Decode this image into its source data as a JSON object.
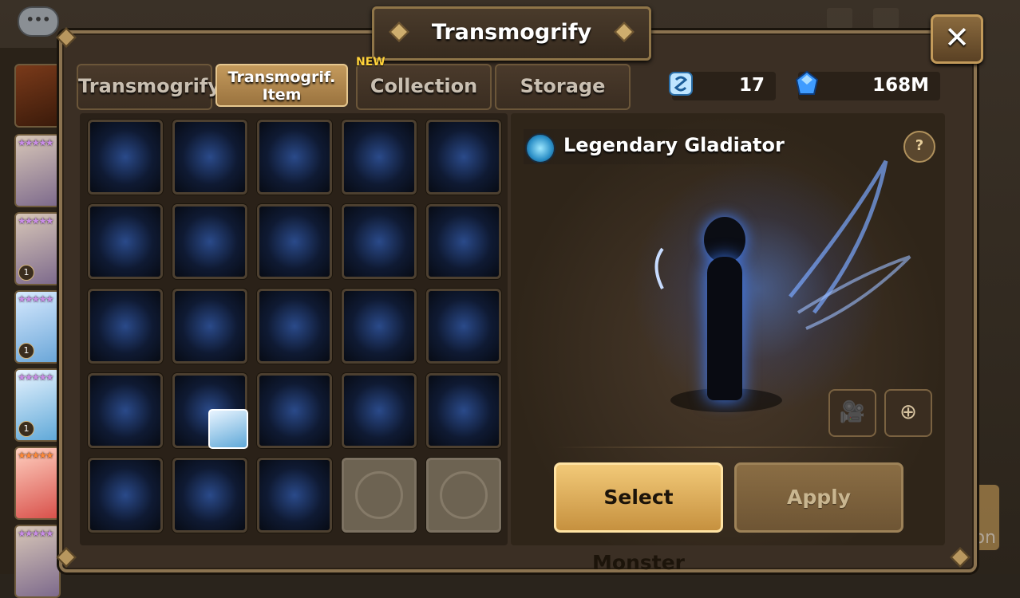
{
  "window": {
    "title": "Transmogrify",
    "close_glyph": "✕"
  },
  "tabs": [
    {
      "label": "Transmogrify",
      "active": false
    },
    {
      "label": "Transmogrif. Item",
      "active": true
    },
    {
      "label": "Collection",
      "active": false,
      "badge": "NEW"
    },
    {
      "label": "Storage",
      "active": false
    }
  ],
  "currency": {
    "transmog_stone": {
      "icon": "transmog-stone-icon",
      "value": "17"
    },
    "crystal": {
      "icon": "crystal-icon",
      "value": "168M"
    }
  },
  "preview": {
    "item_name": "Legendary Gladiator",
    "help_glyph": "?",
    "video_icon": "video-camera-icon",
    "zoom_icon": "zoom-in-icon"
  },
  "actions": {
    "select_monster": "Select Monster",
    "apply": "Apply"
  },
  "monster_list": [
    {
      "stars": "★★★★",
      "level": ""
    },
    {
      "stars": "★★★★★",
      "level": ""
    },
    {
      "stars": "★★★★★",
      "level": "1"
    },
    {
      "stars": "★★★★★",
      "level": "1"
    },
    {
      "stars": "★★★★★",
      "level": "1"
    },
    {
      "stars": "★★★★★",
      "level": ""
    },
    {
      "stars": "★★★★★",
      "level": ""
    }
  ],
  "side_fragment_text": "on",
  "colors": {
    "accent_gold": "#c6913f",
    "panel_dark": "#2a2118",
    "effect_blue": "#3f7fff"
  }
}
